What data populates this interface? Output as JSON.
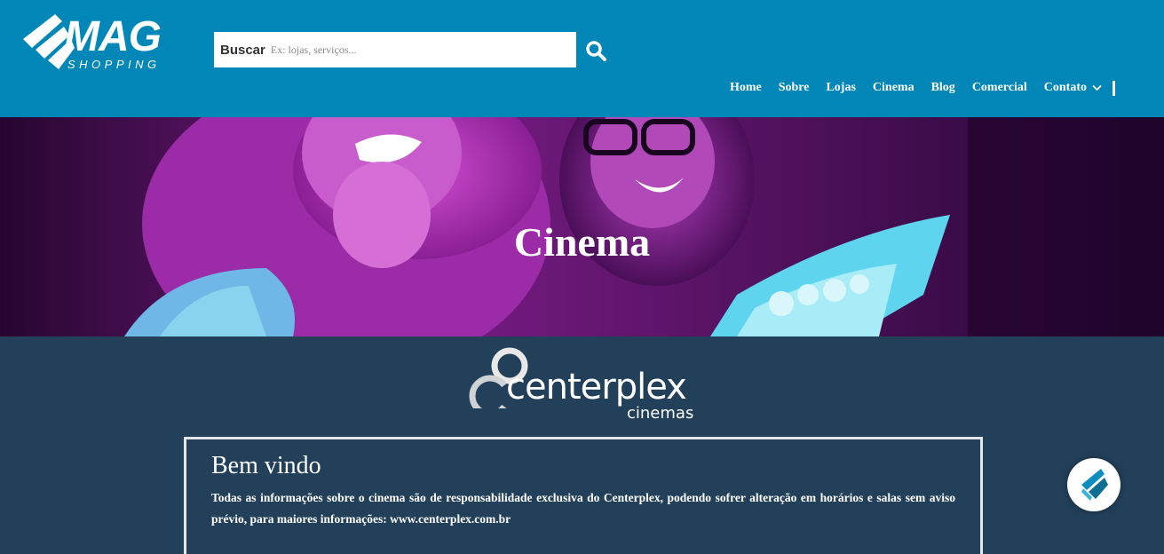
{
  "header": {
    "logo": {
      "text": "MAG",
      "subtext": "SHOPPING",
      "color": "#ffffff"
    },
    "search": {
      "label": "Buscar",
      "placeholder": "Ex: lojas, serviços...",
      "icon": "search-icon"
    },
    "nav": [
      {
        "label": "Home"
      },
      {
        "label": "Sobre"
      },
      {
        "label": "Lojas"
      },
      {
        "label": "Cinema"
      },
      {
        "label": "Blog"
      },
      {
        "label": "Comercial"
      },
      {
        "label": "Contato",
        "icon": "chevron-down-icon"
      }
    ],
    "background": "#0087b7"
  },
  "hero": {
    "title": "Cinema",
    "tint": "#a72bb0"
  },
  "brand": {
    "name": "centerplex",
    "sub": "cinemas"
  },
  "welcome": {
    "title": "Bem vindo",
    "text": "Todas as informações sobre o cinema são de responsabilidade exclusiva do Centerplex, podendo sofrer alteração em horários e salas sem aviso prévio, para maiores informações: www.centerplex.com.br"
  },
  "fab": {
    "icon": "mag-logo-icon"
  },
  "colors": {
    "page_bg": "#22405a",
    "accent": "#0087b7"
  }
}
